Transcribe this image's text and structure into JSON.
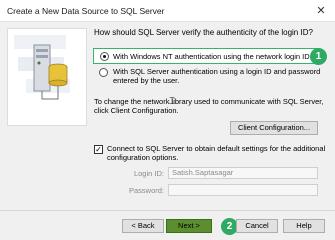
{
  "window": {
    "title": "Create a New Data Source to SQL Server",
    "close_glyph": "✕"
  },
  "main": {
    "question": "How should SQL Server verify the authenticity of the login ID?",
    "auth_options": [
      {
        "label": "With Windows NT authentication using the network login ID.",
        "selected": true
      },
      {
        "label": "With SQL Server authentication using a login ID and password entered by the user.",
        "selected": false
      }
    ],
    "netlib_text": "To change the network library used to communicate with SQL Server, click Client Configuration.",
    "client_config_label": "Client Configuration...",
    "connect_checkbox": {
      "checked": true,
      "glyph": "✓",
      "label": "Connect to SQL Server to obtain default settings for the additional configuration options."
    },
    "login_id_label": "Login ID:",
    "login_id_value": "Satish.Saptasagar",
    "password_label": "Password:",
    "password_value": ""
  },
  "footer": {
    "back_label": "< Back",
    "next_label": "Next >",
    "cancel_label": "Cancel",
    "help_label": "Help"
  },
  "annotations": {
    "step1": "1",
    "step2": "2",
    "badge_color": "#2eaa62"
  },
  "icons": {
    "illustration": "server-database-illustration-icon",
    "cursor": "mouse-cursor-icon"
  }
}
